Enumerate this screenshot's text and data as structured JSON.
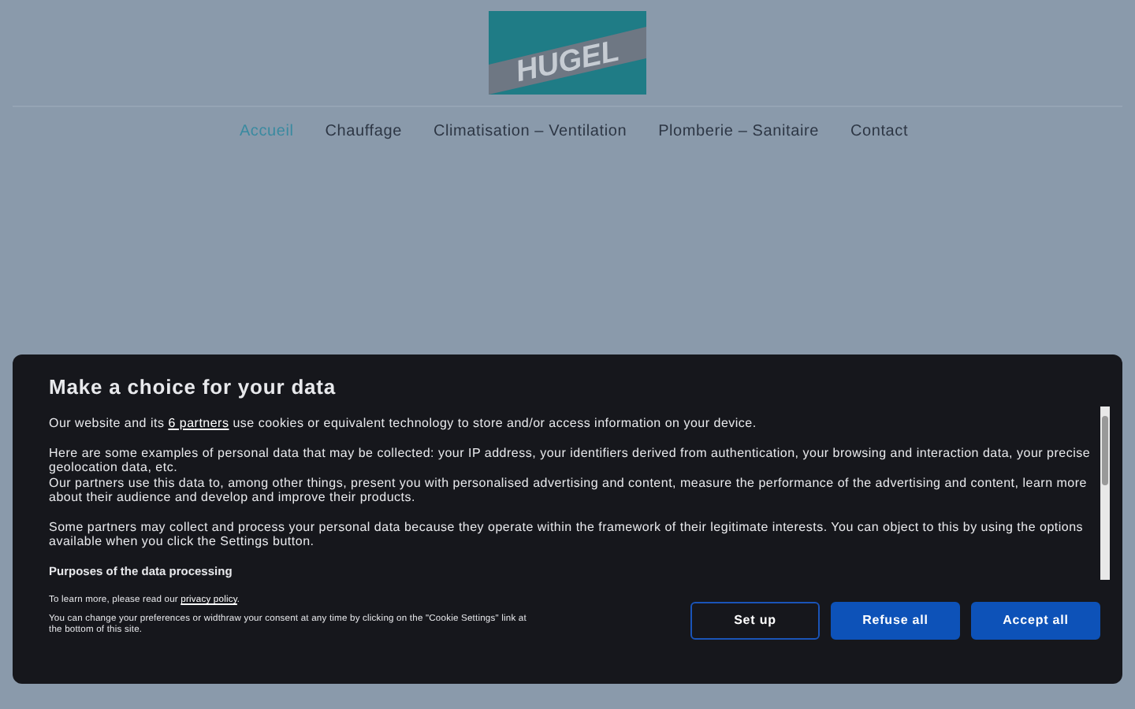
{
  "logo": {
    "text": "HUGEL"
  },
  "nav": [
    {
      "label": "Accueil",
      "selected": true
    },
    {
      "label": "Chauffage",
      "selected": false
    },
    {
      "label": "Climatisation – Ventilation",
      "selected": false
    },
    {
      "label": "Plomberie – Sanitaire",
      "selected": false
    },
    {
      "label": "Contact",
      "selected": false
    }
  ],
  "consent": {
    "title": "Make a choice for your data",
    "intro": {
      "before": "Our website and its ",
      "link": "6 partners",
      "after": " use cookies or equivalent technology to store and/or access information on your device."
    },
    "paragraphs": [
      "Here are some examples of personal data that may be collected: your IP address, your identifiers derived from authentication, your browsing and interaction data, your precise geolocation data, etc.\nOur partners use this data to, among other things, present you with personalised advertising and content, measure the performance of the advertising and content, learn more about their audience and develop and improve their products.",
      "Some partners may collect and process your personal data because they operate within the framework of their legitimate interests. You can object to this by using the options available when you click the Settings button."
    ],
    "section_heading": "Purposes of the data processing",
    "learn_more": {
      "before": "To learn more, please read our ",
      "link": "privacy policy",
      "after": "."
    },
    "footnote": "You can change your preferences or widthraw your consent at any time by clicking on the \"Cookie Settings\" link at the bottom of this site.",
    "buttons": [
      {
        "label": "Set up",
        "kind": "outline"
      },
      {
        "label": "Refuse all",
        "kind": "filled"
      },
      {
        "label": "Accept all",
        "kind": "filled"
      }
    ]
  }
}
